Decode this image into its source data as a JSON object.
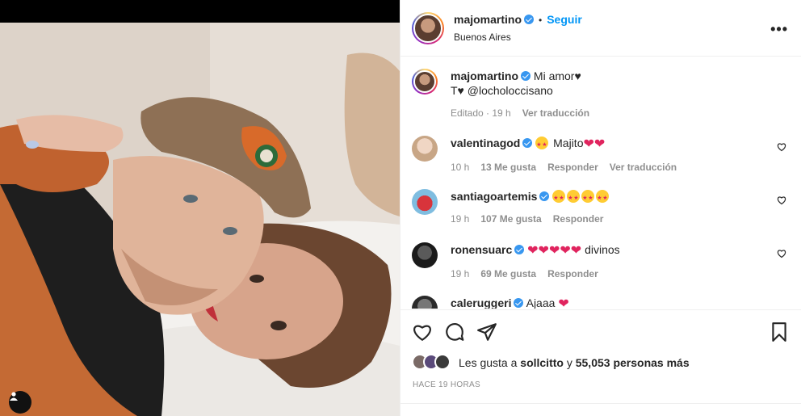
{
  "post": {
    "username": "majomartino",
    "follow_label": "Seguir",
    "dot": "•",
    "location": "Buenos Aires",
    "more": "•••"
  },
  "caption": {
    "username": "majomartino",
    "text_line1": "Mi amor♥",
    "text_line2": "T♥ @locholoccisano",
    "edited": "Editado · 19 h",
    "translate": "Ver traducción"
  },
  "comments": [
    {
      "username": "valentinagod",
      "text": "Majito",
      "time": "10 h",
      "likes": "13 Me gusta",
      "reply": "Responder",
      "translate": "Ver traducción"
    },
    {
      "username": "santiagoartemis",
      "time": "19 h",
      "likes": "107 Me gusta",
      "reply": "Responder"
    },
    {
      "username": "ronensuarc",
      "text": "divinos",
      "time": "19 h",
      "likes": "69 Me gusta",
      "reply": "Responder"
    },
    {
      "username": "caleruggeri",
      "text": "Ajaaa"
    }
  ],
  "likes": {
    "prefix": "Les gusta a",
    "user": "sollcitto",
    "middle": "y",
    "count": "55,053 personas más"
  },
  "timestamp": "HACE 19 HORAS",
  "icons": [
    "verified-icon",
    "more-icon",
    "heart-icon",
    "comment-icon",
    "share-icon",
    "bookmark-icon",
    "user-tag-icon"
  ],
  "colors": {
    "link": "#0095f6",
    "verified": "#3897f0",
    "heart": "#e0245e",
    "muted": "#8e8e8e"
  }
}
